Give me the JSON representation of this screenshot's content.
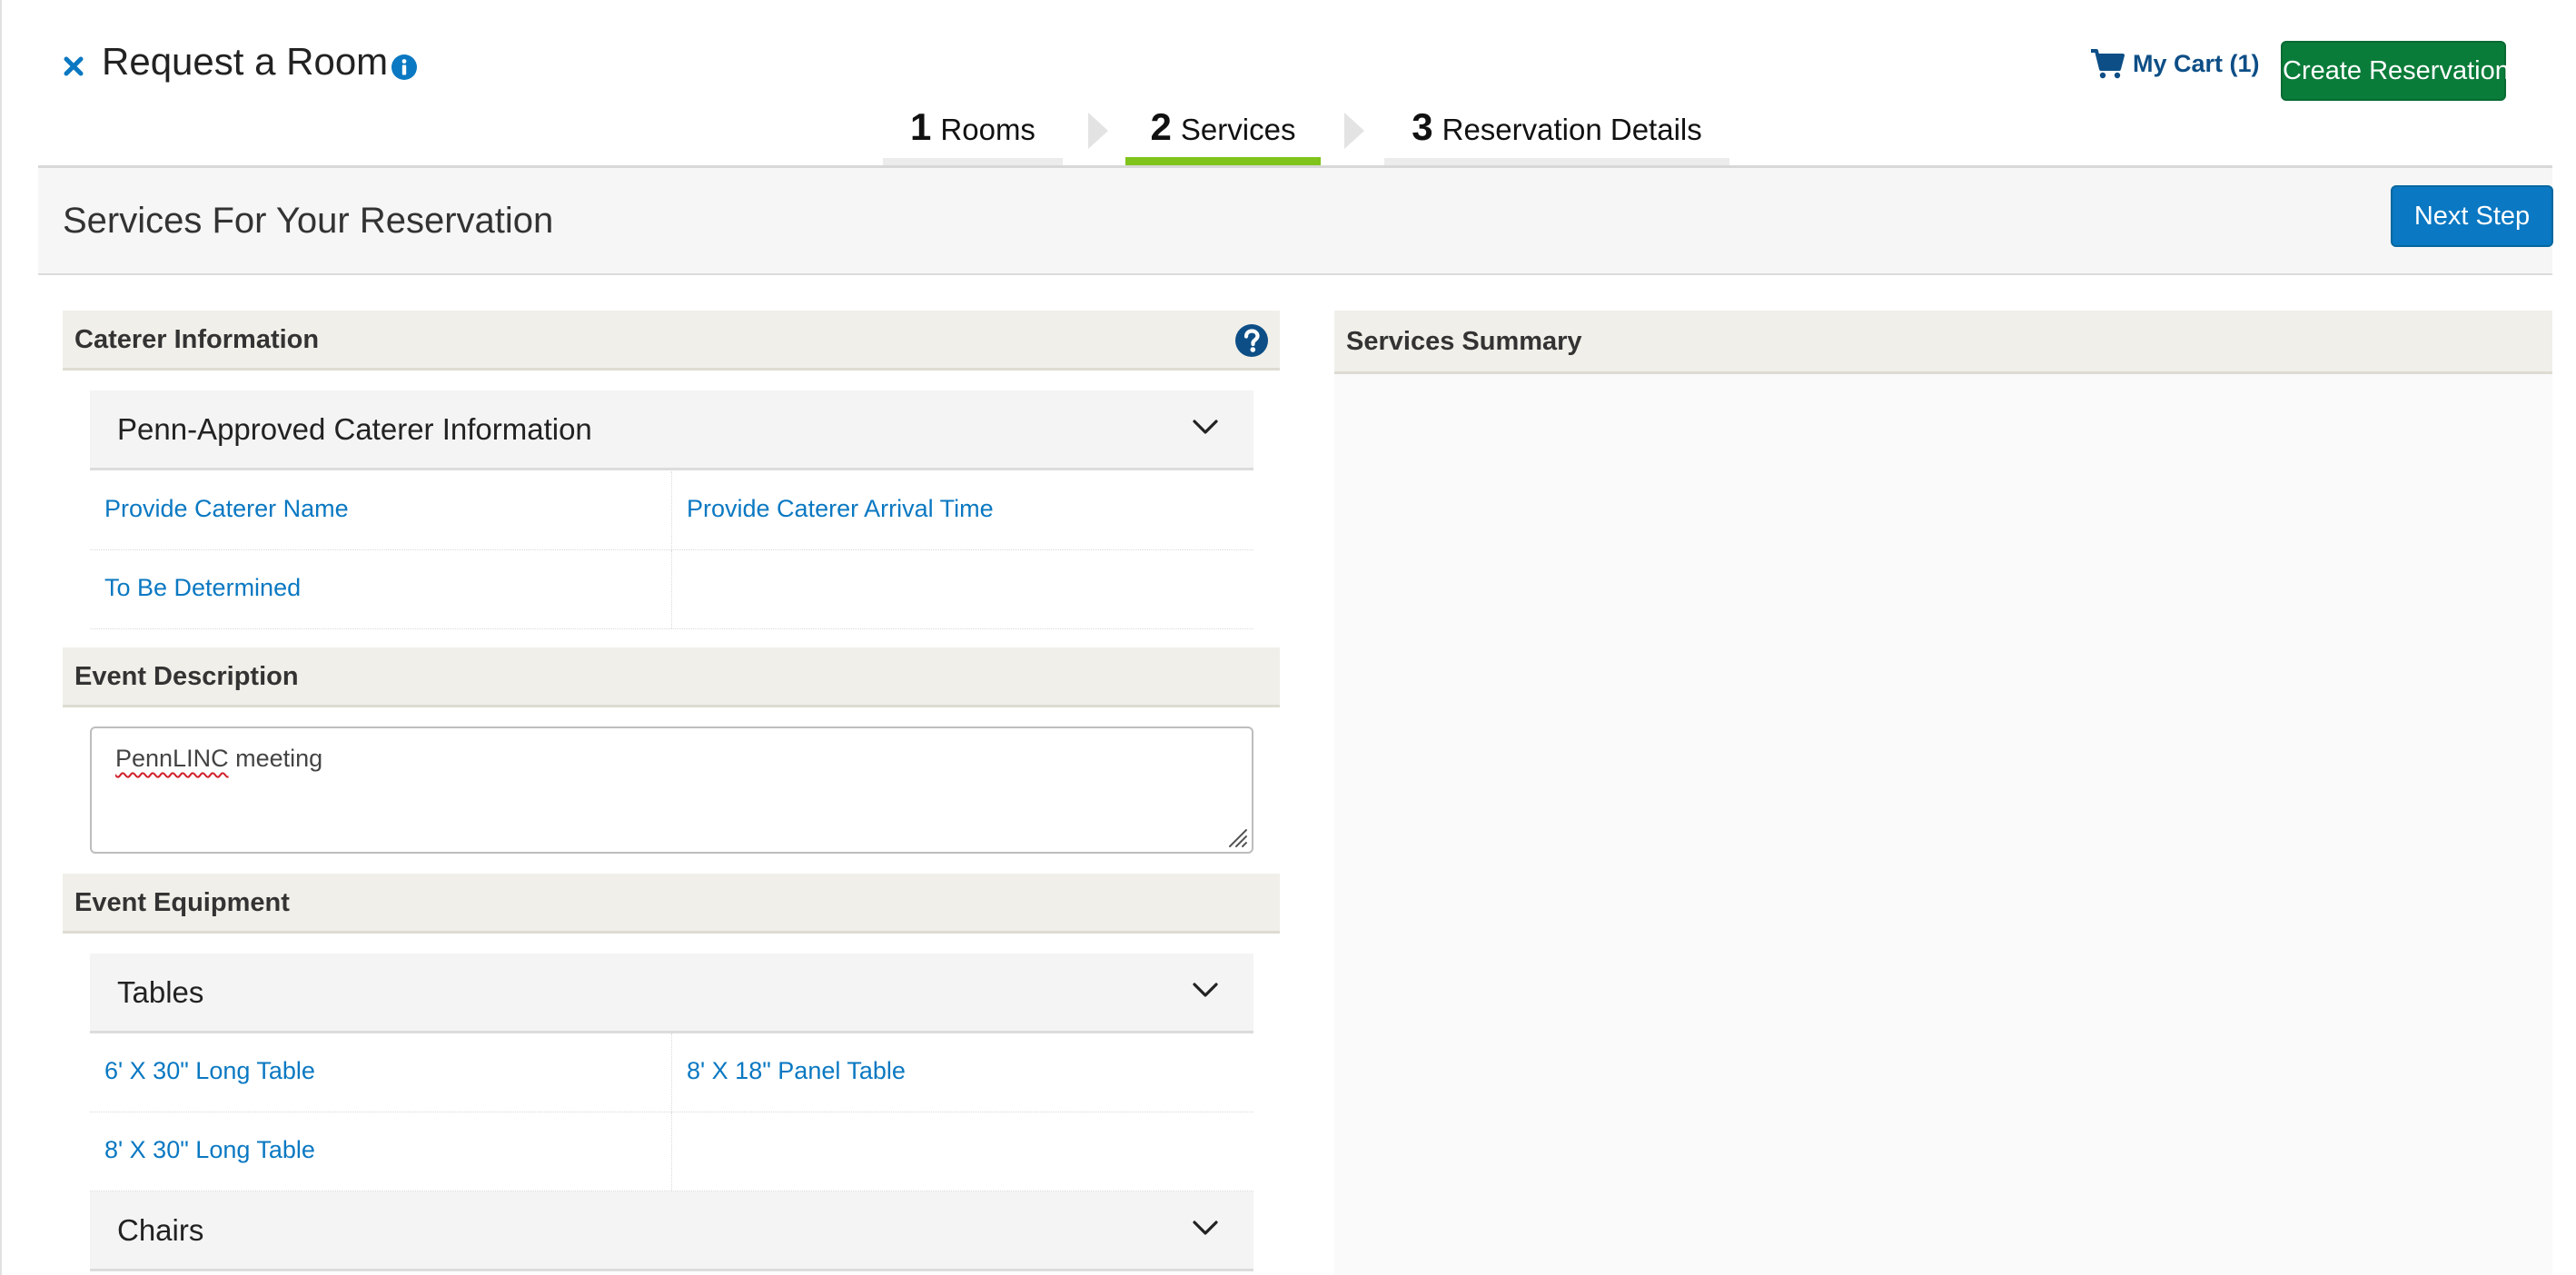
{
  "header": {
    "title": "Request a Room",
    "cart_label": "My Cart (1)",
    "create_label": "Create Reservation"
  },
  "steps": [
    {
      "num": "1",
      "label": "Rooms"
    },
    {
      "num": "2",
      "label": "Services",
      "active": true
    },
    {
      "num": "3",
      "label": "Reservation Details"
    }
  ],
  "subheader": {
    "title": "Services For Your Reservation",
    "next_label": "Next Step"
  },
  "caterer": {
    "title": "Caterer Information",
    "accordion_title": "Penn-Approved Caterer Information",
    "options": [
      "Provide Caterer Name",
      "Provide Caterer Arrival Time",
      "To Be Determined"
    ]
  },
  "event_description": {
    "title": "Event Description",
    "value_misspelled": "PennLINC",
    "value_rest": " meeting"
  },
  "equipment": {
    "title": "Event Equipment",
    "tables_title": "Tables",
    "tables": [
      "6' X 30\" Long Table",
      "8' X 18\" Panel Table",
      "8' X 30\" Long Table"
    ],
    "chairs_title": "Chairs"
  },
  "summary": {
    "title": "Services Summary"
  },
  "icons": {
    "close": "close-icon",
    "info": "info-icon",
    "cart": "cart-icon",
    "help": "help-icon",
    "chevron": "chevron-down-icon",
    "resize": "resize-grip-icon"
  },
  "colors": {
    "create_button": "#0a7c3a",
    "next_button": "#0a78c2",
    "active_step": "#7fc31c",
    "link": "#0a78c2",
    "cart_text": "#0d4e86",
    "section_bg": "#f0efe9"
  }
}
